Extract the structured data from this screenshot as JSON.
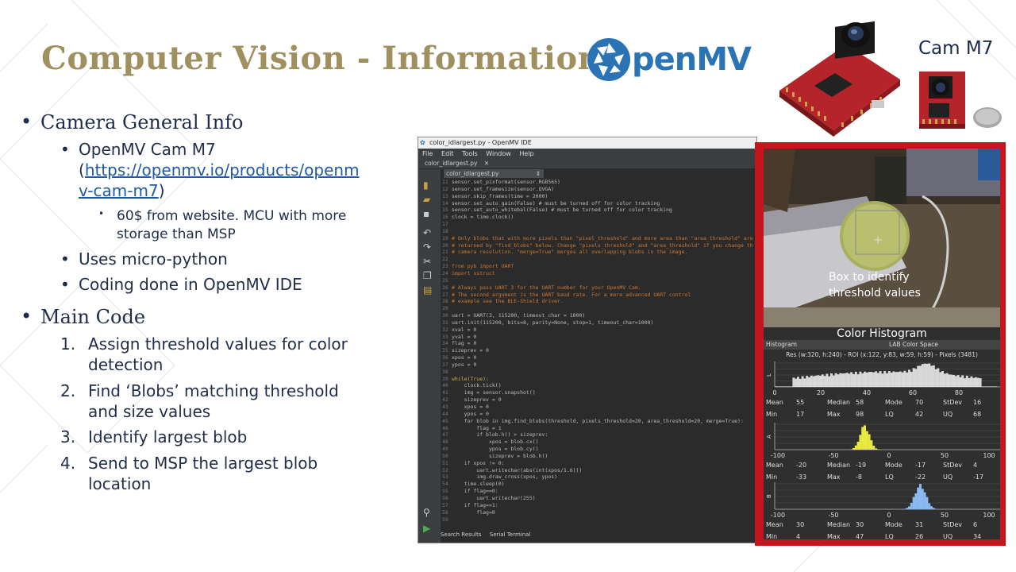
{
  "slide": {
    "title": "Computer Vision - Information",
    "logo_text": "penMV",
    "logo_icon": "shutter-aperture-icon",
    "camera_label": "Cam M7"
  },
  "bullets": {
    "camera_info": {
      "heading": "Camera General Info",
      "model_line1": "OpenMV Cam M7",
      "link_open": "(",
      "link_part1": "https://openmv.io/products/openm",
      "link_part2": "v-cam-m7",
      "link_close": ")",
      "price_line1": "60$ from website. MCU with more",
      "price_line2": "storage than MSP",
      "micropython": "Uses micro-python",
      "ide": "Coding done in OpenMV IDE"
    },
    "main_code": {
      "heading": "Main Code",
      "steps": [
        {
          "num": "1.",
          "line1": "Assign threshold values for color",
          "line2": "detection"
        },
        {
          "num": "2.",
          "line1": "Find ‘Blobs’ matching threshold",
          "line2": "and size values"
        },
        {
          "num": "3.",
          "line1": "Identify largest blob",
          "line2": ""
        },
        {
          "num": "4.",
          "line1": "Send to MSP the largest blob",
          "line2": "location"
        }
      ]
    }
  },
  "ide": {
    "window_title": "color_idlargest.py - OpenMV IDE",
    "menu": [
      "File",
      "Edit",
      "Tools",
      "Window",
      "Help"
    ],
    "tab": "color_idlargest.py",
    "file_tab": "color_idlargest.py",
    "bottom_tabs": [
      "Search Results",
      "Serial Terminal"
    ],
    "code": [
      {
        "n": "11",
        "t": "sensor.set_pixformat(sensor.RGB565)",
        "k": "def"
      },
      {
        "n": "12",
        "t": "sensor.set_framesize(sensor.QVGA)",
        "k": "def"
      },
      {
        "n": "13",
        "t": "sensor.skip_frames(time = 2000)",
        "k": "def"
      },
      {
        "n": "14",
        "t": "sensor.set_auto_gain(False) # must be turned off for color tracking",
        "k": "def"
      },
      {
        "n": "15",
        "t": "sensor.set_auto_whitebal(False) # must be turned off for color tracking",
        "k": "def"
      },
      {
        "n": "16",
        "t": "clock = time.clock()",
        "k": "def"
      },
      {
        "n": "17",
        "t": "",
        "k": "def"
      },
      {
        "n": "18",
        "t": "",
        "k": "def"
      },
      {
        "n": "19",
        "t": "# Only blobs that with more pixels than \"pixel_threshold\" and more area than \"area_threshold\" are",
        "k": "cmt"
      },
      {
        "n": "20",
        "t": "# returned by \"find_blobs\" below. Change \"pixels_threshold\" and \"area_threshold\" if you change th",
        "k": "cmt"
      },
      {
        "n": "21",
        "t": "# camera resolution. \"merge=True\" merges all overlapping blobs in the image.",
        "k": "cmt"
      },
      {
        "n": "22",
        "t": "",
        "k": "def"
      },
      {
        "n": "23",
        "t": "from pyb import UART",
        "k": "cmt"
      },
      {
        "n": "24",
        "t": "import ustruct",
        "k": "cmt"
      },
      {
        "n": "25",
        "t": "",
        "k": "def"
      },
      {
        "n": "26",
        "t": "# Always pass UART 3 for the UART number for your OpenMV Cam.",
        "k": "cmt"
      },
      {
        "n": "27",
        "t": "# The second argument is the UART baud rate. For a more advanced UART control",
        "k": "cmt"
      },
      {
        "n": "28",
        "t": "# example see the BLE-Shield driver.",
        "k": "cmt"
      },
      {
        "n": "29",
        "t": "",
        "k": "def"
      },
      {
        "n": "30",
        "t": "uart = UART(3, 115200, timeout_char = 1000)",
        "k": "def"
      },
      {
        "n": "31",
        "t": "uart.init(115200, bits=8, parity=None, stop=1, timeout_char=1000)",
        "k": "def"
      },
      {
        "n": "32",
        "t": "xval = 0",
        "k": "def"
      },
      {
        "n": "33",
        "t": "yval = 0",
        "k": "def"
      },
      {
        "n": "34",
        "t": "flag = 0",
        "k": "def"
      },
      {
        "n": "35",
        "t": "sizeprev = 0",
        "k": "def"
      },
      {
        "n": "36",
        "t": "xpos = 0",
        "k": "def"
      },
      {
        "n": "37",
        "t": "ypos = 0",
        "k": "def"
      },
      {
        "n": "38",
        "t": "",
        "k": "def"
      },
      {
        "n": "39",
        "t": "while(True):",
        "k": "kw"
      },
      {
        "n": "40",
        "t": "    clock.tick()",
        "k": "def"
      },
      {
        "n": "41",
        "t": "    img = sensor.snapshot()",
        "k": "def"
      },
      {
        "n": "42",
        "t": "    sizeprev = 0",
        "k": "def"
      },
      {
        "n": "43",
        "t": "    xpos = 0",
        "k": "def"
      },
      {
        "n": "44",
        "t": "    ypos = 0",
        "k": "def"
      },
      {
        "n": "45",
        "t": "    for blob in img.find_blobs(threshold, pixels_threshold=20, area_threshold=20, merge=True):",
        "k": "def"
      },
      {
        "n": "46",
        "t": "        flag = 1",
        "k": "def"
      },
      {
        "n": "47",
        "t": "        if blob.h() > sizeprev:",
        "k": "def"
      },
      {
        "n": "48",
        "t": "            xpos = blob.cx()",
        "k": "def"
      },
      {
        "n": "49",
        "t": "            ypos = blob.cy()",
        "k": "def"
      },
      {
        "n": "50",
        "t": "            sizeprev = blob.h()",
        "k": "def"
      },
      {
        "n": "51",
        "t": "    if xpos != 0:",
        "k": "def"
      },
      {
        "n": "52",
        "t": "        uart.writechar(abs(int(xpos/1.6)))",
        "k": "def"
      },
      {
        "n": "53",
        "t": "        img.draw_cross(xpos, ypos)",
        "k": "def"
      },
      {
        "n": "54",
        "t": "    time.sleep(0)",
        "k": "def"
      },
      {
        "n": "55",
        "t": "    if flag==0:",
        "k": "def"
      },
      {
        "n": "56",
        "t": "        uart.writechar(255)",
        "k": "def"
      },
      {
        "n": "57",
        "t": "    if flag==1:",
        "k": "def"
      },
      {
        "n": "58",
        "t": "        flag=0",
        "k": "def"
      },
      {
        "n": "59",
        "t": "",
        "k": "def"
      }
    ]
  },
  "camera_view": {
    "annotation_line1": "Box to identify",
    "annotation_line2": "threshold values",
    "histogram_title": "Color Histogram",
    "header_left": "Histogram",
    "header_right": "LAB Color Space",
    "info": "Res (w:320, h:240) - ROI (x:122, y:83, w:59, h:59) - Pixels (3481)",
    "channels": [
      {
        "axis_label": "L",
        "ticks": [
          "0",
          "20",
          "40",
          "60",
          "80"
        ],
        "row1": {
          "mean_label": "Mean",
          "mean": "55",
          "median_label": "Median",
          "median": "58",
          "mode_label": "Mode",
          "mode": "70",
          "stdev_label": "StDev",
          "stdev": "16"
        },
        "row2": {
          "min_label": "Min",
          "min": "17",
          "max_label": "Max",
          "max": "98",
          "lq_label": "LQ",
          "lq": "42",
          "uq_label": "UQ",
          "uq": "68"
        },
        "color": "#d8d8d8"
      },
      {
        "axis_label": "A",
        "ticks": [
          "-100",
          "-50",
          "0",
          "50",
          "100"
        ],
        "row1": {
          "mean_label": "Mean",
          "mean": "-20",
          "median_label": "Median",
          "median": "-19",
          "mode_label": "Mode",
          "mode": "-17",
          "stdev_label": "StDev",
          "stdev": "4"
        },
        "row2": {
          "min_label": "Min",
          "min": "-33",
          "max_label": "Max",
          "max": "-8",
          "lq_label": "LQ",
          "lq": "-22",
          "uq_label": "UQ",
          "uq": "-17"
        },
        "color": "#e8e840"
      },
      {
        "axis_label": "B",
        "ticks": [
          "-100",
          "-50",
          "0",
          "50",
          "100"
        ],
        "row1": {
          "mean_label": "Mean",
          "mean": "30",
          "median_label": "Median",
          "median": "30",
          "mode_label": "Mode",
          "mode": "31",
          "stdev_label": "StDev",
          "stdev": "6"
        },
        "row2": {
          "min_label": "Min",
          "min": "4",
          "max_label": "Max",
          "max": "47",
          "lq_label": "LQ",
          "lq": "26",
          "uq_label": "UQ",
          "uq": "34"
        },
        "color": "#8ab8f0"
      }
    ]
  },
  "colors": {
    "title": "#a09060",
    "text": "#1f2d4a",
    "frame": "#c4161c",
    "logo": "#2a73b5"
  }
}
